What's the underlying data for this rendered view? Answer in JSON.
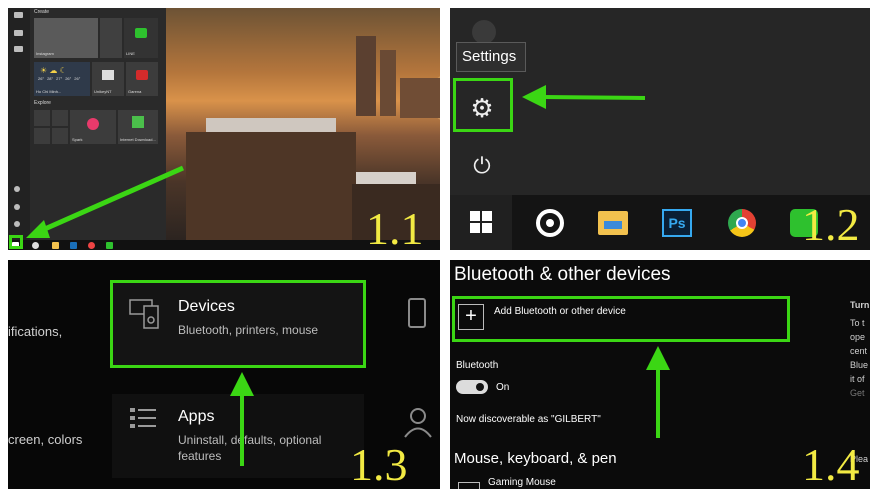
{
  "panel1": {
    "step_label": "1.1",
    "start_menu": {
      "section_create": "Create",
      "section_explore": "Explore",
      "tiles": [
        {
          "label": "Instagram"
        },
        {
          "label": "LINE"
        },
        {
          "label": "Ho Chi Minh..."
        },
        {
          "label": "UnikeyNT"
        },
        {
          "label": "Garena"
        },
        {
          "label": "Spark"
        },
        {
          "label": "Internet Download..."
        }
      ],
      "weather_temps": [
        "26°",
        "28°",
        "27°",
        "26°",
        "26°"
      ]
    },
    "taskbar_icons": [
      "windows-start-icon",
      "groove-music-icon",
      "file-explorer-icon",
      "photoshop-icon",
      "chrome-icon",
      "line-icon"
    ]
  },
  "panel2": {
    "step_label": "1.2",
    "tooltip": "Settings",
    "taskbar": {
      "photoshop_label": "Ps"
    }
  },
  "panel3": {
    "step_label": "1.3",
    "left_fragment_1": "ifications,",
    "left_fragment_2": "creen, colors",
    "devices": {
      "title": "Devices",
      "subtitle": "Bluetooth, printers, mouse"
    },
    "apps": {
      "title": "Apps",
      "subtitle_line1": "Uninstall, defaults, optional",
      "subtitle_line2": "features"
    }
  },
  "panel4": {
    "step_label": "1.4",
    "heading": "Bluetooth & other devices",
    "add_device": "Add Bluetooth or other device",
    "bluetooth_label": "Bluetooth",
    "toggle_state": "On",
    "discoverable": "Now discoverable as \"GILBERT\"",
    "section2": "Mouse, keyboard, & pen",
    "device1": "Gaming Mouse",
    "side_lines": [
      "Turn",
      "To t",
      "ope",
      "cent",
      "Blue",
      "it of",
      "",
      "Get"
    ],
    "side_bottom": "Plea"
  },
  "colors": {
    "highlight_green": "#3bd614",
    "step_label_yellow": "#f2ea43"
  }
}
